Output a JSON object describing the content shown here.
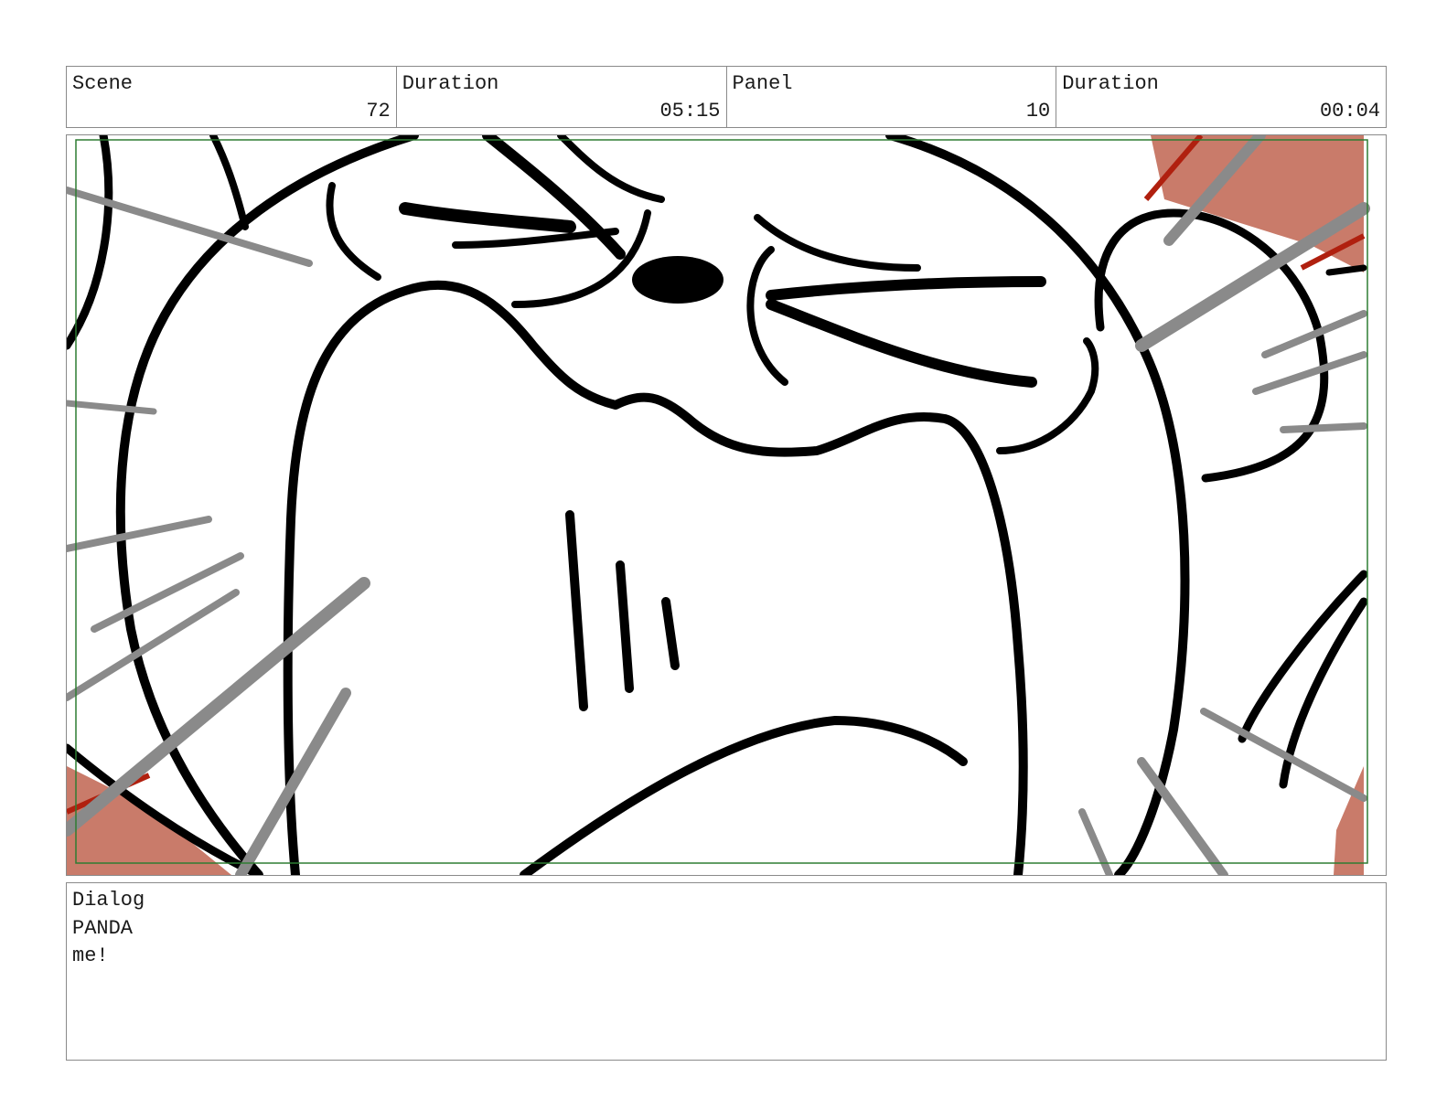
{
  "header": {
    "scene": {
      "label": "Scene",
      "value": "72"
    },
    "scene_duration": {
      "label": "Duration",
      "value": "05:15"
    },
    "panel": {
      "label": "Panel",
      "value": "10"
    },
    "panel_duration": {
      "label": "Duration",
      "value": "00:04"
    }
  },
  "panel_image": {
    "subject": "extreme close-up sketch of a panda's angry face with speed lines",
    "colors": {
      "ink": "#000000",
      "speed_lines": "#8a8a8a",
      "accent_fill": "#c97b6a",
      "accent_line": "#b0200f",
      "safe_area": "#2e7d32"
    }
  },
  "dialog": {
    "label": "Dialog",
    "character": "PANDA",
    "line": "me!"
  }
}
